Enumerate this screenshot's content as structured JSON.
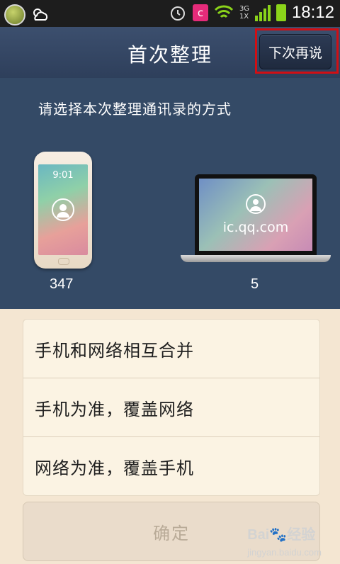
{
  "status_bar": {
    "network_label": "3G 1X",
    "time": "18:12"
  },
  "header": {
    "title": "首次整理",
    "later_label": "下次再说"
  },
  "hero": {
    "prompt": "请选择本次整理通讯录的方式",
    "phone": {
      "clock": "9:01",
      "count": "347"
    },
    "web": {
      "site": "ic.qq.com",
      "count": "5"
    }
  },
  "options": [
    {
      "label": "手机和网络相互合并"
    },
    {
      "label": "手机为准，覆盖网络"
    },
    {
      "label": "网络为准，覆盖手机"
    }
  ],
  "confirm_label": "确定",
  "watermark": {
    "brand": "Bai",
    "brand2": "经验",
    "domain": "jingyan.baidu.com"
  },
  "colors": {
    "header_bg": "#3c4f6e",
    "hero_bg": "#344a66",
    "page_bg": "#f4e6d2",
    "highlight": "#d10f14"
  }
}
